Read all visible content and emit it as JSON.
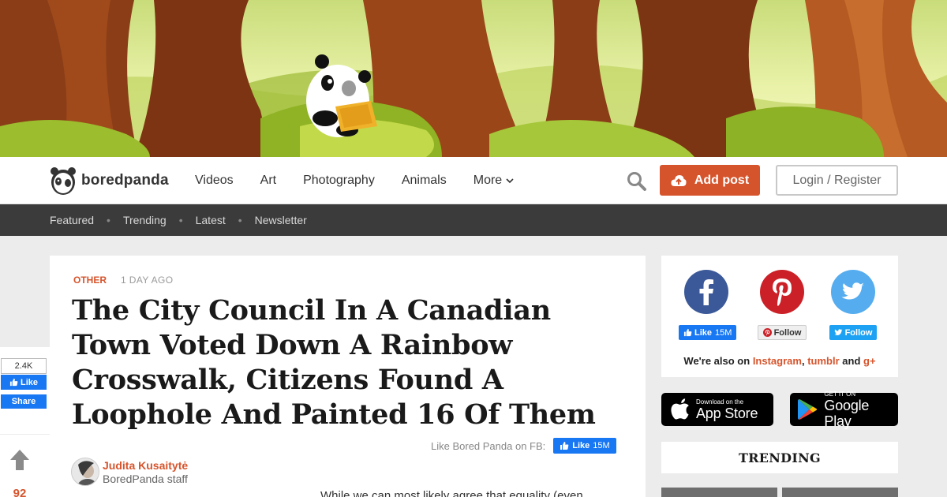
{
  "brand": {
    "name": "boredpanda"
  },
  "nav": {
    "links": [
      "Videos",
      "Art",
      "Photography",
      "Animals"
    ],
    "more_label": "More",
    "add_post": "Add post",
    "login": "Login / Register"
  },
  "subnav": {
    "items": [
      "Featured",
      "Trending",
      "Latest",
      "Newsletter"
    ]
  },
  "article": {
    "category": "OTHER",
    "date": "1 DAY AGO",
    "title": "The City Council In A Canadian Town Voted Down A Rainbow Crosswalk, Citizens Found A Loophole And Painted 16 Of Them",
    "fb_like_label": "Like Bored Panda on FB:",
    "fb_like_button": "Like",
    "fb_like_count": "15M",
    "author_name": "Judita Kusaitytė",
    "author_role": "BoredPanda staff",
    "intro": "While we can most likely agree that equality (even"
  },
  "sharebar": {
    "like_count": "2.4K",
    "like_label": "Like",
    "share_label": "Share",
    "vote_count": "92"
  },
  "sidebar": {
    "facebook": {
      "button": "Like",
      "count": "15M"
    },
    "pinterest": {
      "button": "Follow"
    },
    "twitter": {
      "button": "Follow"
    },
    "also_prefix": "We're also on",
    "also_links": [
      "Instagram",
      "tumblr",
      "g+"
    ],
    "also_and": "and",
    "app_store": {
      "small": "Download on the",
      "big": "App Store"
    },
    "google_play": {
      "small": "GET IT ON",
      "big": "Google Play"
    },
    "trending_title": "TRENDING"
  },
  "colors": {
    "accent": "#d6542c",
    "facebook": "#1877f2",
    "dark_nav": "#3b3b3b"
  }
}
